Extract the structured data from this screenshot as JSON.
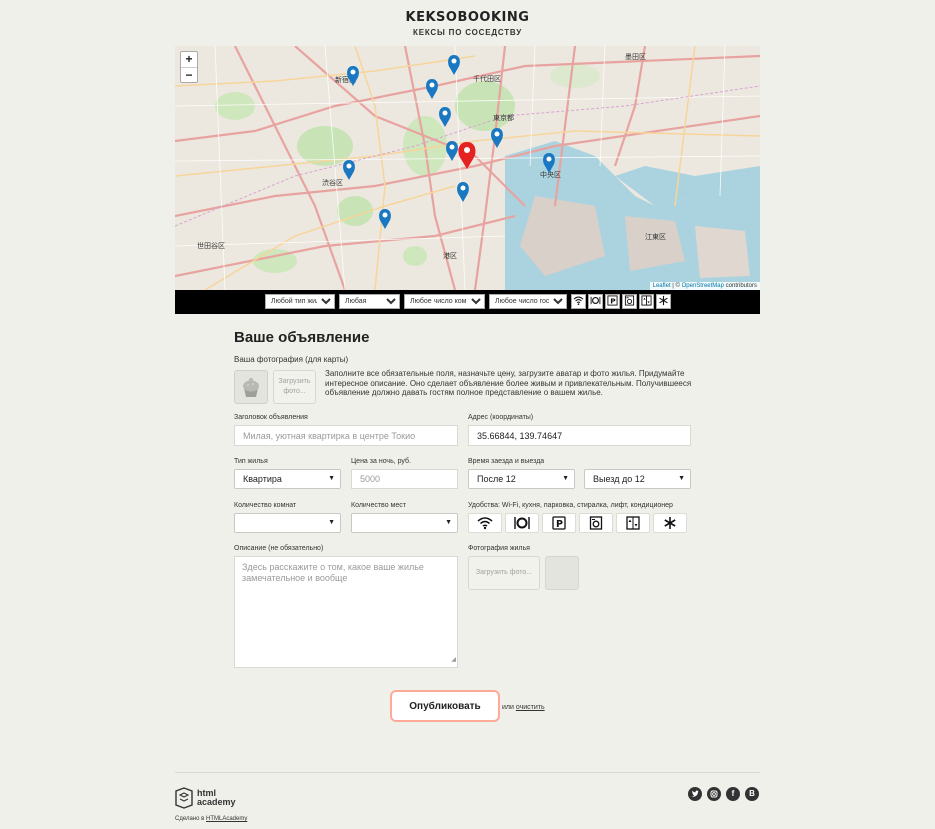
{
  "header": {
    "logo": "KEKSOBOOKING",
    "tagline": "КЕКСЫ ПО СОСЕДСТВУ"
  },
  "map": {
    "zoom_in": "+",
    "zoom_out": "−",
    "attribution_leaflet": "Leaflet",
    "attribution_sep": " | © ",
    "attribution_osm": "OpenStreetMap",
    "attribution_rest": " contributors",
    "place_labels": [
      "新宿区",
      "千代田区",
      "東京都",
      "中央区",
      "渋谷区",
      "港区",
      "世田谷区",
      "江東区",
      "墨田区"
    ],
    "pin_colors": {
      "pin": "#1a78c2",
      "main_pin": "#e52121"
    }
  },
  "filters": {
    "type": "Любой тип жилья",
    "price": "Любая",
    "rooms": "Любое число комнат",
    "guests": "Любое число гостей",
    "feature_icons": [
      "wifi-icon",
      "dishwasher-icon",
      "parking-icon",
      "washer-icon",
      "elevator-icon",
      "conditioner-icon"
    ]
  },
  "form": {
    "title": "Ваше объявление",
    "avatar_label": "Ваша фотография (для карты)",
    "avatar_upload": "Загрузить фото...",
    "hint": "Заполните все обязательные поля, назначьте цену, загрузите аватар и фото жилья. Придумайте интересное описание. Оно сделает объявление более живым и привлекательным. Получившееся объявление должно давать гостям полное представление о вашем жилье.",
    "title_label": "Заголовок объявления",
    "title_placeholder": "Милая, уютная квартирка в центре Токио",
    "address_label": "Адрес (координаты)",
    "address_value": "35.66844, 139.74647",
    "type_label": "Тип жилья",
    "type_value": "Квартира",
    "price_label": "Цена за ночь, руб.",
    "price_placeholder": "5000",
    "time_label": "Время заезда и выезда",
    "checkin_value": "После 12",
    "checkout_value": "Выезд до 12",
    "rooms_label": "Количество комнат",
    "capacity_label": "Количество мест",
    "features_label": "Удобства: Wi-Fi, кухня, парковка, стиралка, лифт, кондиционер",
    "description_label": "Описание (не обязательно)",
    "description_placeholder": "Здесь расскажите о том, какое ваше жилье замечательное и вообще",
    "photo_label": "Фотография жилья",
    "photo_upload": "Загрузить фото...",
    "submit": "Опубликовать",
    "or_text": "или",
    "reset": "очистить"
  },
  "footer": {
    "academy_line1": "html",
    "academy_line2": "academy",
    "made_text": "Сделано в",
    "made_link": "HTMLAcademy",
    "social": [
      "twitter-icon",
      "instagram-icon",
      "facebook-icon",
      "vk-icon"
    ]
  }
}
